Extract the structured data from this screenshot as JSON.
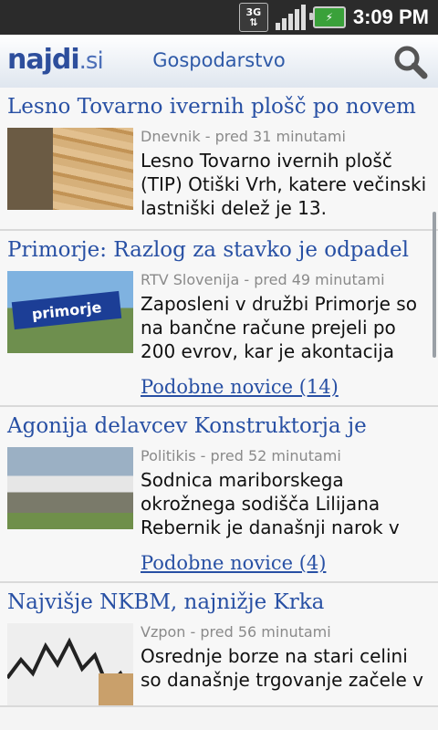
{
  "status_bar": {
    "network": "3G",
    "time": "3:09 PM"
  },
  "app_bar": {
    "logo": "najdi",
    "logo_suffix": ".si",
    "section": "Gospodarstvo"
  },
  "articles": [
    {
      "title": "Lesno Tovarno ivernih plošč po novem",
      "source": "Dnevnik - pred 31 minutami",
      "snippet": "Lesno Tovarno ivernih plošč (TIP) Otiški Vrh, katere večinski lastniški delež je 13.",
      "similar": ""
    },
    {
      "title": "Primorje: Razlog za stavko je odpadel",
      "source": "RTV Slovenija - pred 49 minutami",
      "snippet": "Zaposleni v družbi Primorje so na bančne račune prejeli po 200 evrov, kar je akontacija",
      "similar": "Podobne novice (14)"
    },
    {
      "title": "Agonija delavcev Konstruktorja je",
      "source": "Politikis - pred 52 minutami",
      "snippet": "Sodnica mariborskega okrožnega sodišča Lilijana Rebernik je današnji narok v",
      "similar": "Podobne novice (4)"
    },
    {
      "title": "Najvišje NKBM, najnižje Krka",
      "source": "Vzpon - pred 56 minutami",
      "snippet": "Osrednje borze na stari celini so današnje trgovanje začele v",
      "similar": ""
    }
  ],
  "thumb_text": {
    "banner": "primorje"
  }
}
